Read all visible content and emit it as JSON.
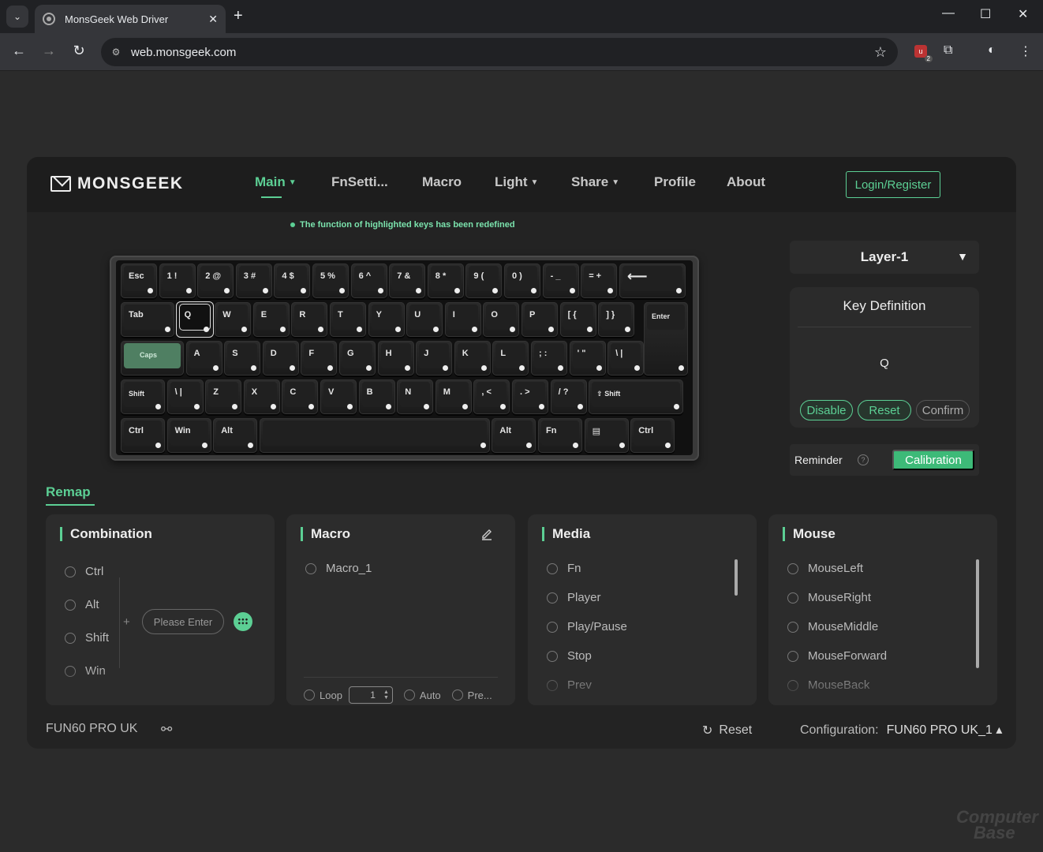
{
  "browser": {
    "tab_title": "MonsGeek Web Driver",
    "url": "web.monsgeek.com",
    "extension_badge": "2"
  },
  "brand": {
    "name": "MONSGEEK"
  },
  "nav": [
    {
      "label": "Main"
    },
    {
      "label": "FnSetti..."
    },
    {
      "label": "Macro"
    },
    {
      "label": "Light"
    },
    {
      "label": "Share"
    },
    {
      "label": "Profile"
    },
    {
      "label": "About"
    }
  ],
  "auth": {
    "login_label": "Login/Register"
  },
  "notice": "The function of highlighted keys has been redefined",
  "keyboard": {
    "row1": [
      "Esc",
      "1 !",
      "2 @",
      "3 #",
      "4 $",
      "5 %",
      "6 ^",
      "7 &",
      "8 *",
      "9 (",
      "0 )",
      "- _",
      "= +",
      "⟵"
    ],
    "row2": [
      "Tab",
      "Q",
      "W",
      "E",
      "R",
      "T",
      "Y",
      "U",
      "I",
      "O",
      "P",
      "[ {",
      "] }",
      "Enter"
    ],
    "row3": [
      "Caps",
      "A",
      "S",
      "D",
      "F",
      "G",
      "H",
      "J",
      "K",
      "L",
      "; :",
      "' \"",
      "\\ |"
    ],
    "row4": [
      "Shift",
      "\\ |",
      "Z",
      "X",
      "C",
      "V",
      "B",
      "N",
      "M",
      ", <",
      ". >",
      "/ ?",
      "⇧ Shift"
    ],
    "row5": [
      "Ctrl",
      "Win",
      "Alt",
      "",
      "Alt",
      "Fn",
      "▤",
      "Ctrl"
    ],
    "highlighted_key": "Caps",
    "selected_key": "Q"
  },
  "layer": {
    "selected": "Layer-1"
  },
  "key_definition": {
    "title": "Key Definition",
    "value": "Q",
    "disable_label": "Disable",
    "reset_label": "Reset",
    "confirm_label": "Confirm"
  },
  "reminder": {
    "label": "Reminder",
    "help": "?",
    "calibration_label": "Calibration"
  },
  "remap": {
    "title": "Remap",
    "combination": {
      "title": "Combination",
      "options": [
        "Ctrl",
        "Alt",
        "Shift",
        "Win"
      ],
      "plus": "+",
      "input_placeholder": "Please Enter"
    },
    "macro": {
      "title": "Macro",
      "items": [
        "Macro_1"
      ],
      "loop_label": "Loop",
      "loop_value": "1",
      "auto_label": "Auto",
      "press_label": "Pre..."
    },
    "media": {
      "title": "Media",
      "items": [
        "Fn",
        "Player",
        "Play/Pause",
        "Stop",
        "Prev"
      ]
    },
    "mouse": {
      "title": "Mouse",
      "items": [
        "MouseLeft",
        "MouseRight",
        "MouseMiddle",
        "MouseForward",
        "MouseBack"
      ]
    }
  },
  "footer": {
    "device": "FUN60 PRO UK",
    "reset_label": "Reset",
    "config_label": "Configuration:",
    "config_value": "FUN60 PRO UK_1 ▴"
  },
  "watermark": {
    "line1": "Computer",
    "line2": "Base"
  },
  "colors": {
    "accent": "#5ccf94",
    "background": "#2b2b2b",
    "panel": "#2c2c2c"
  }
}
